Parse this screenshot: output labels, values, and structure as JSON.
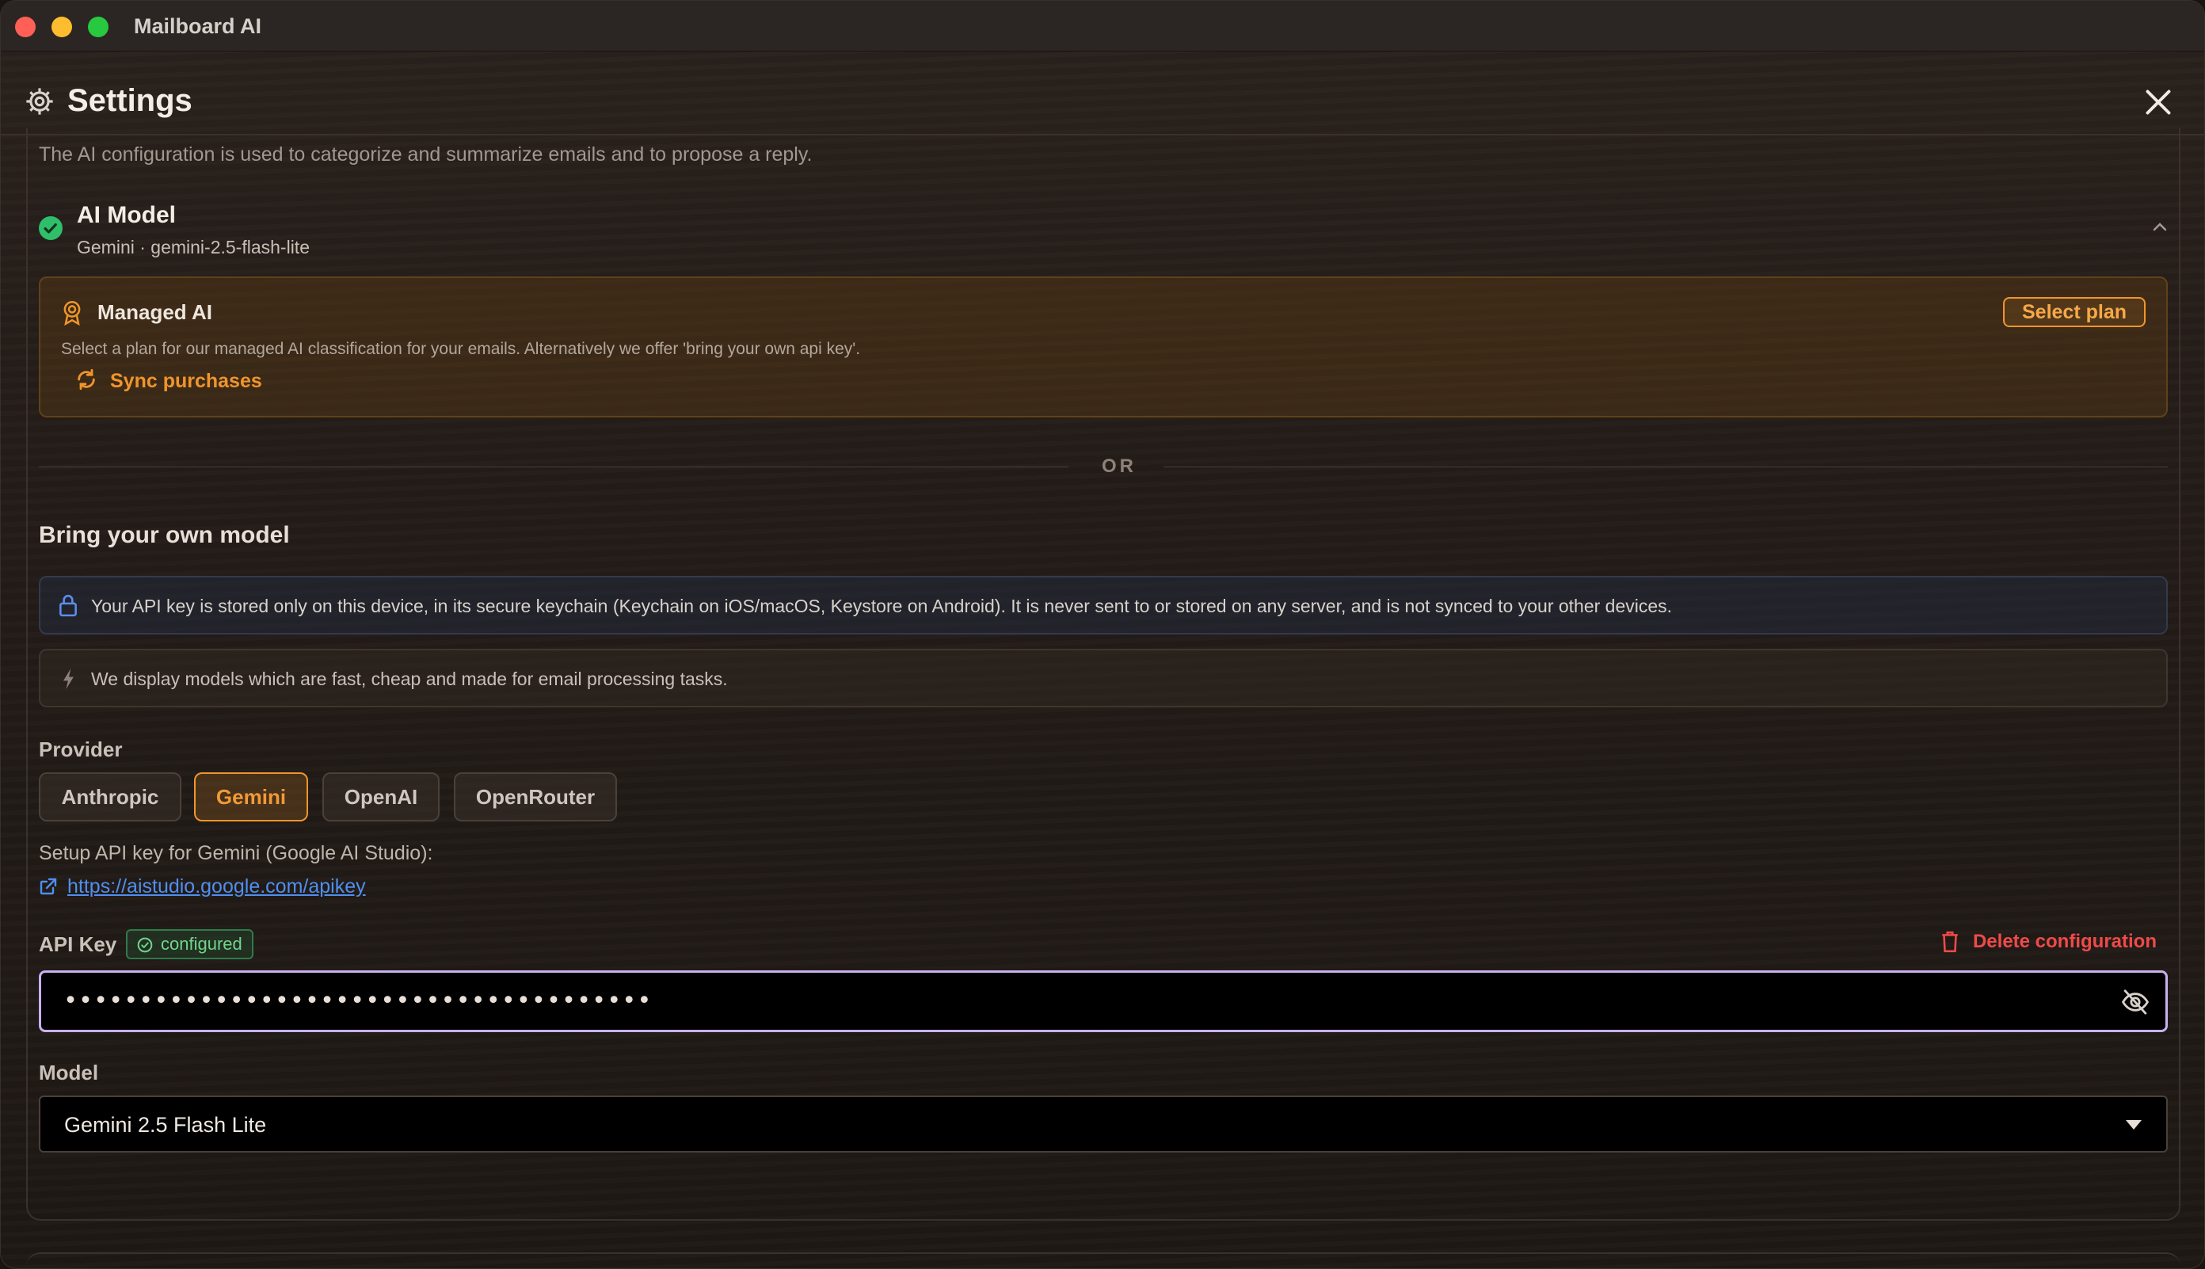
{
  "window": {
    "title": "Mailboard AI"
  },
  "header": {
    "title": "Settings"
  },
  "intro": "The AI configuration is used to categorize and summarize emails and to propose a reply.",
  "ai_model": {
    "title": "AI Model",
    "subtitle": "Gemini · gemini-2.5-flash-lite"
  },
  "managed": {
    "title": "Managed AI",
    "description": "Select a plan for our managed AI classification for your emails. Alternatively we offer 'bring your own api key'.",
    "sync_label": "Sync purchases",
    "select_plan_label": "Select plan"
  },
  "divider": "OR",
  "byom": {
    "title": "Bring your own model",
    "info": "Your API key is stored only on this device, in its secure keychain (Keychain on iOS/macOS, Keystore on Android). It is never sent to or stored on any server, and is not synced to your other devices.",
    "hint": "We display models which are fast, cheap and made for email processing tasks."
  },
  "provider": {
    "label": "Provider",
    "options": [
      "Anthropic",
      "Gemini",
      "OpenAI",
      "OpenRouter"
    ],
    "selected": "Gemini"
  },
  "setup": {
    "text": "Setup API key for Gemini (Google AI Studio):",
    "link": "https://aistudio.google.com/apikey"
  },
  "api_key": {
    "label": "API Key",
    "badge": "configured",
    "delete_label": "Delete configuration",
    "masked_value": "•••••••••••••••••••••••••••••••••••••••"
  },
  "model": {
    "label": "Model",
    "selected": "Gemini 2.5 Flash Lite"
  },
  "colors": {
    "accent": "#f0952b",
    "success": "#2fbf6a",
    "danger": "#ef4a4a",
    "link": "#4f8ff0",
    "focus": "#c8b0f0"
  }
}
